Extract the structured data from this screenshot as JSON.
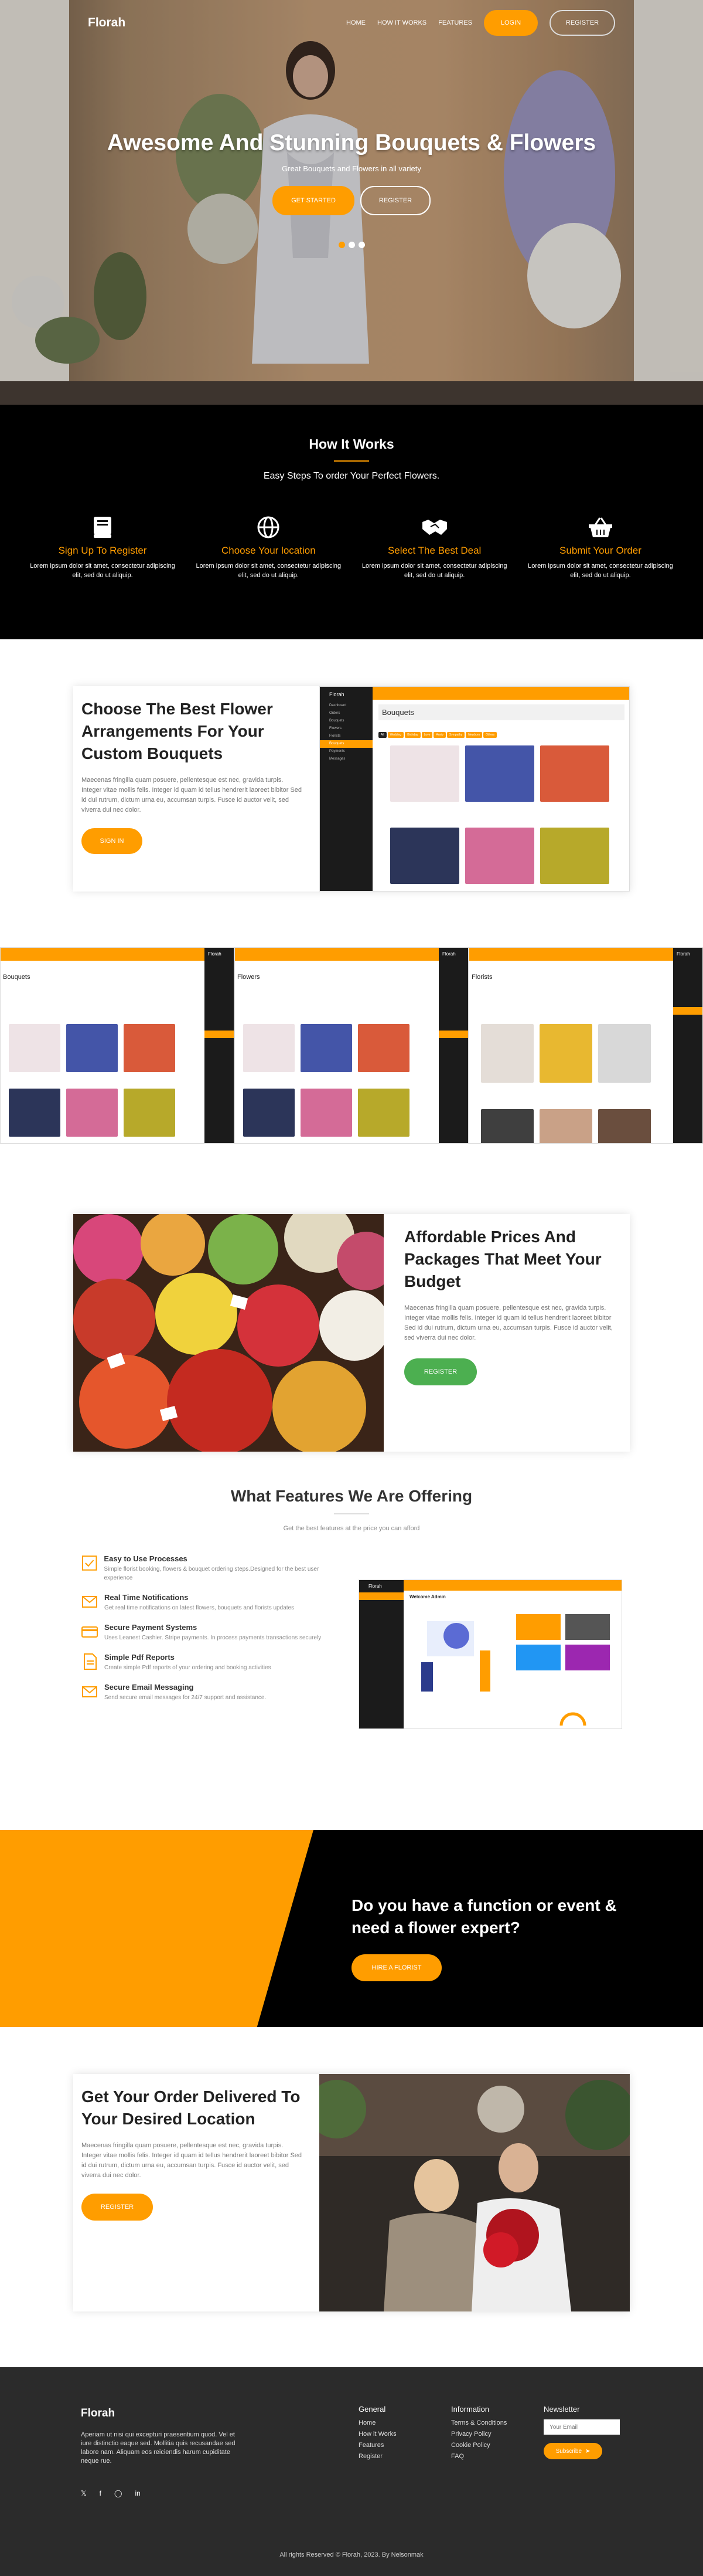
{
  "nav": {
    "logo": "Florah",
    "links": [
      "HOME",
      "HOW IT WORKS",
      "FEATURES"
    ],
    "login": "LOGIN",
    "register": "REGISTER"
  },
  "hero": {
    "title": "Awesome And Stunning Bouquets & Flowers",
    "subtitle": "Great Bouquets and Flowers in all variety",
    "cta_primary": "GET STARTED",
    "cta_secondary": "REGISTER"
  },
  "how": {
    "title": "How It Works",
    "subtitle": "Easy Steps To order Your Perfect Flowers.",
    "steps": [
      {
        "icon": "book-icon",
        "title": "Sign Up To Register",
        "text": "Lorem ipsum dolor sit amet, consectetur adipiscing elit, sed do ut aliquip."
      },
      {
        "icon": "globe-icon",
        "title": "Choose Your location",
        "text": "Lorem ipsum dolor sit amet, consectetur adipiscing elit, sed do ut aliquip."
      },
      {
        "icon": "handshake-icon",
        "title": "Select The Best Deal",
        "text": "Lorem ipsum dolor sit amet, consectetur adipiscing elit, sed do ut aliquip."
      },
      {
        "icon": "basket-icon",
        "title": "Submit Your Order",
        "text": "Lorem ipsum dolor sit amet, consectetur adipiscing elit, sed do ut aliquip."
      }
    ]
  },
  "block1": {
    "title": "Choose The Best Flower Arrangements For Your Custom Bouquets",
    "text": "Maecenas fringilla quam posuere, pellentesque est nec, gravida turpis. Integer vitae mollis felis. Integer id quam id tellus hendrerit laoreet bibitor Sed id dui rutrum, dictum urna eu, accumsan turpis. Fusce id auctor velit, sed viverra dui nec dolor.",
    "button": "SIGN IN",
    "mock_title": "Bouquets",
    "mock_brand": "Florah"
  },
  "strip": {
    "panels": [
      "Bouquets",
      "Flowers",
      "Florists"
    ],
    "brand": "Florah"
  },
  "block2": {
    "title": "Affordable Prices And Packages That Meet Your Budget",
    "text": "Maecenas fringilla quam posuere, pellentesque est nec, gravida turpis. Integer vitae mollis felis. Integer id quam id tellus hendrerit laoreet bibitor Sed id dui rutrum, dictum urna eu, accumsan turpis. Fusce id auctor velit, sed viverra dui nec dolor.",
    "button": "REGISTER"
  },
  "features": {
    "title": "What Features We Are Offering",
    "subtitle": "Get the best features at the price you can afford",
    "items": [
      {
        "title": "Easy to Use Processes",
        "text": "Simple florist booking, flowers & bouquet ordering steps.Designed for the best user experience"
      },
      {
        "title": "Real Time Notifications",
        "text": "Get real time notifications on latest flowers, bouquets and florists updates"
      },
      {
        "title": "Secure Payment Systems",
        "text": "Uses Leanest Cashier. Stripe payments. In process payments transactions securely"
      },
      {
        "title": "Simple Pdf Reports",
        "text": "Create simple Pdf reports of your ordering and booking activities"
      },
      {
        "title": "Secure Email Messaging",
        "text": "Send secure email messages for 24/7 support and assistance."
      }
    ],
    "mock_brand": "Florah",
    "mock_welcome": "Welcome Admin"
  },
  "cta": {
    "title": "Do you have a function or event & need a flower expert?",
    "button": "HIRE A FLORIST"
  },
  "block3": {
    "title": "Get Your Order Delivered To Your Desired Location",
    "text": "Maecenas fringilla quam posuere, pellentesque est nec, gravida turpis. Integer vitae mollis felis. Integer id quam id tellus hendrerit laoreet bibitor Sed id dui rutrum, dictum urna eu, accumsan turpis. Fusce id auctor velit, sed viverra dui nec dolor.",
    "button": "REGISTER"
  },
  "footer": {
    "brand": "Florah",
    "about": "Aperiam ut nisi qui excepturi praesentium quod. Vel et iure distinctio eaque sed. Mollitia quis recusandae sed labore nam. Aliquam eos reiciendis harum cupiditate neque rue.",
    "general_title": "General",
    "general": [
      "Home",
      "How it Works",
      "Features",
      "Register"
    ],
    "info_title": "Information",
    "info": [
      "Terms & Conditions",
      "Privacy Policy",
      "Cookie Policy",
      "FAQ"
    ],
    "news_title": "Newsletter",
    "email_placeholder": "Your Email",
    "subscribe": "Subscribe",
    "copyright": "All rights Reserved © Florah, 2023. By Nelsonmak"
  },
  "colors": {
    "accent": "#ff9d00",
    "dark": "#000000",
    "footer": "#2b2b2b",
    "green": "#4caf50"
  }
}
